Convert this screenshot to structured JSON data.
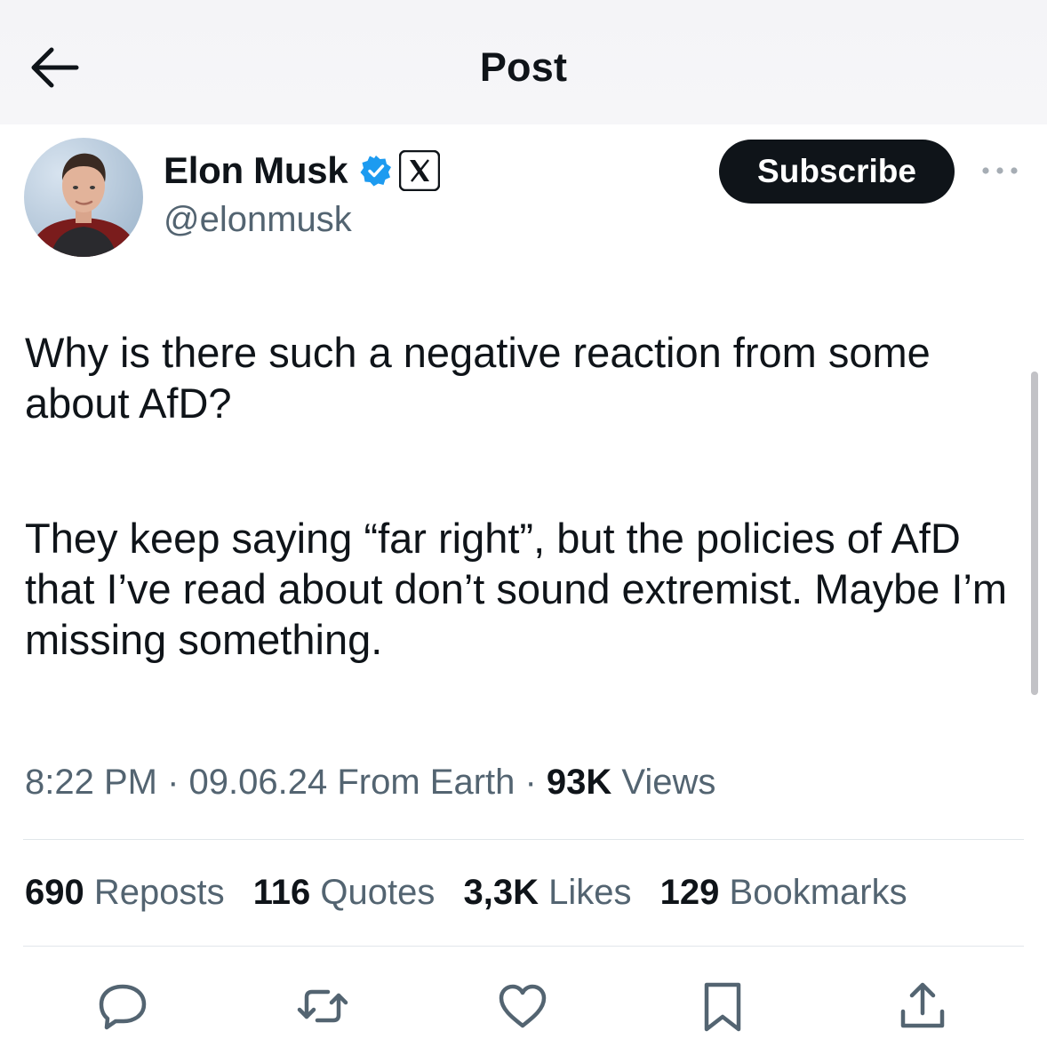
{
  "header": {
    "title": "Post",
    "back_icon": "arrow-left-icon"
  },
  "author": {
    "name": "Elon Musk",
    "handle": "@elonmusk",
    "verified_color": "#1d9bf0",
    "badge_icon": "x-logo-icon"
  },
  "subscribe_label": "Subscribe",
  "post": {
    "paragraph_1": "Why is there such a negative reaction from some about AfD?",
    "paragraph_2": "They keep saying “far right”, but the policies of AfD that I’ve read about don’t sound extremist. Maybe I’m missing something."
  },
  "meta": {
    "time": "8:22 PM",
    "sep1": " · ",
    "date": "09.06.24",
    "location": " From Earth",
    "sep2": " · ",
    "views_count": "93K",
    "views_label": " Views"
  },
  "stats": [
    {
      "count": "690",
      "label": "Reposts"
    },
    {
      "count": "116",
      "label": "Quotes"
    },
    {
      "count": "3,3K",
      "label": "Likes"
    },
    {
      "count": "129",
      "label": "Bookmarks"
    }
  ],
  "actions": [
    "reply-icon",
    "repost-icon",
    "like-icon",
    "bookmark-icon",
    "share-icon"
  ],
  "colors": {
    "text": "#0f1419",
    "secondary": "#536471",
    "accent": "#1d9bf0",
    "button": "#0f1419"
  }
}
